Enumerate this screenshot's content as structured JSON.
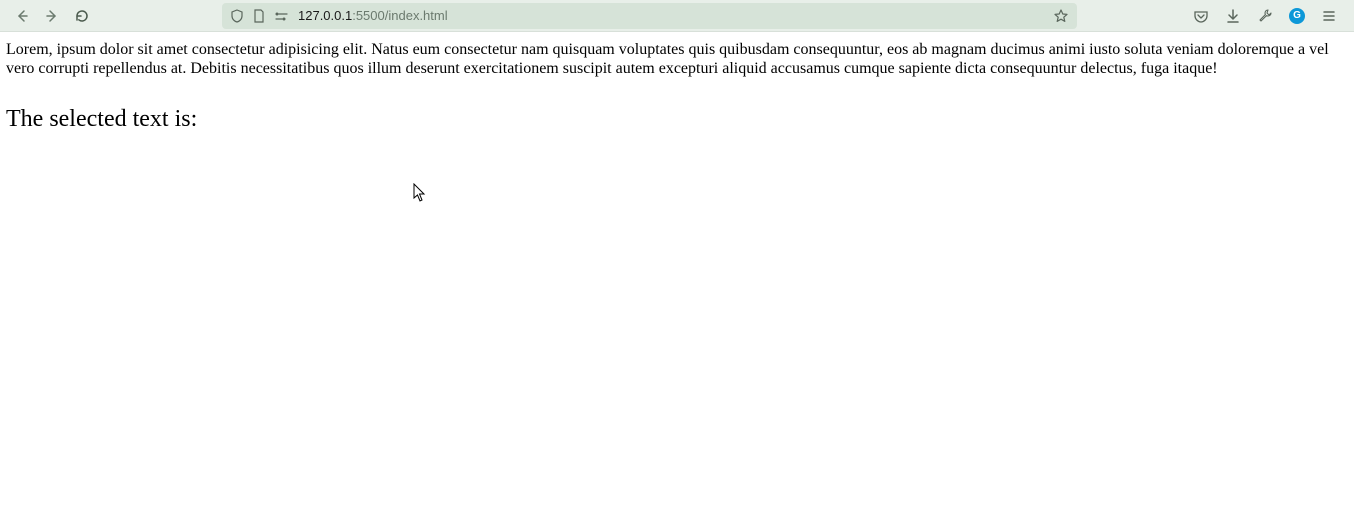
{
  "toolbar": {
    "url_host": "127.0.0.1",
    "url_port_path": ":5500/index.html"
  },
  "page": {
    "lorem": "Lorem, ipsum dolor sit amet consectetur adipisicing elit. Natus eum consectetur nam quisquam voluptates quis quibusdam consequuntur, eos ab magnam ducimus animi iusto soluta veniam doloremque a vel vero corrupti repellendus at. Debitis necessitatibus quos illum deserunt exercitationem suscipit autem excepturi aliquid accusamus cumque sapiente dicta consequuntur delectus, fuga itaque!",
    "heading": "The selected text is:"
  },
  "icons": {
    "ext_g_label": "G"
  }
}
